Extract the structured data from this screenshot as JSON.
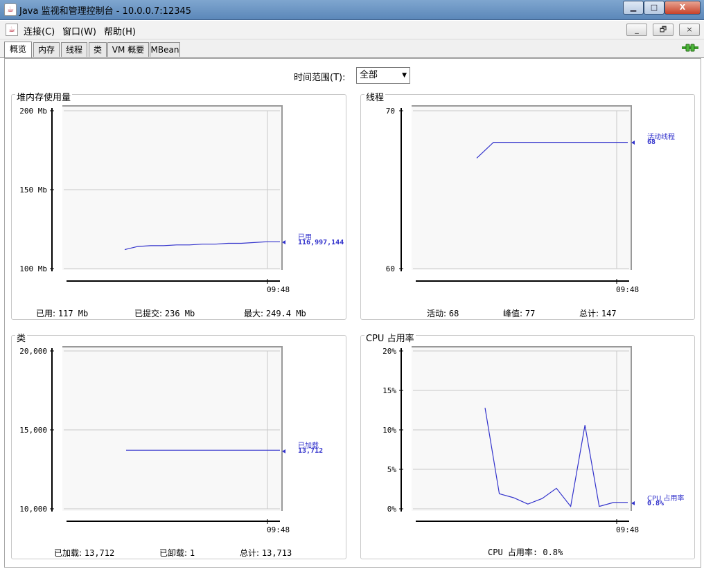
{
  "window": {
    "title": "Java 监视和管理控制台 - 10.0.0.7:12345",
    "min": "▁",
    "max": "□",
    "close": "X"
  },
  "menubar": {
    "items": [
      "连接(C)",
      "窗口(W)",
      "帮助(H)"
    ],
    "mdi_min": "_",
    "mdi_restore": "🗗",
    "mdi_close": "×"
  },
  "tabs": [
    "概览",
    "内存",
    "线程",
    "类",
    "VM 概要",
    "MBean"
  ],
  "time_range": {
    "label": "时间范围(T):",
    "value": "全部"
  },
  "panels": {
    "heap": {
      "title": "堆内存使用量",
      "y_ticks": [
        "200 Mb",
        "150 Mb",
        "100 Mb"
      ],
      "x_tick": "09:48",
      "legend_name": "已用",
      "legend_value": "116,997,144",
      "summary": [
        {
          "k": "已用:",
          "v": "117  Mb"
        },
        {
          "k": "已提交:",
          "v": "236  Mb"
        },
        {
          "k": "最大:",
          "v": "249.4  Mb"
        }
      ]
    },
    "threads": {
      "title": "线程",
      "y_ticks": [
        "70",
        "60"
      ],
      "x_tick": "09:48",
      "legend_name": "活动线程",
      "legend_value": "68",
      "summary": [
        {
          "k": "活动:",
          "v": "68"
        },
        {
          "k": "峰值:",
          "v": "77"
        },
        {
          "k": "总计:",
          "v": "147"
        }
      ]
    },
    "classes": {
      "title": "类",
      "y_ticks": [
        "20,000",
        "15,000",
        "10,000"
      ],
      "x_tick": "09:48",
      "legend_name": "已加载",
      "legend_value": "13,712",
      "summary": [
        {
          "k": "已加载:",
          "v": "13,712"
        },
        {
          "k": "已卸载:",
          "v": "1"
        },
        {
          "k": "总计:",
          "v": "13,713"
        }
      ]
    },
    "cpu": {
      "title": "CPU 占用率",
      "y_ticks": [
        "20%",
        "15%",
        "10%",
        "5%",
        "0%"
      ],
      "x_tick": "09:48",
      "legend_name": "CPU 占用率",
      "legend_value": "0.8%",
      "summary_text": "CPU 占用率: 0.8%"
    }
  },
  "chart_data": [
    {
      "type": "line",
      "title": "堆内存使用量",
      "ylabel": "Mb",
      "ylim": [
        100,
        200
      ],
      "series": [
        {
          "name": "已用",
          "values": [
            112,
            114,
            114.5,
            114.5,
            115,
            115,
            115.5,
            115.5,
            116,
            116,
            116.5,
            117,
            117
          ]
        }
      ]
    },
    {
      "type": "line",
      "title": "线程",
      "ylim": [
        60,
        70
      ],
      "series": [
        {
          "name": "活动线程",
          "values": [
            67,
            68,
            68,
            68,
            68,
            68,
            68,
            68,
            68,
            68
          ]
        }
      ]
    },
    {
      "type": "line",
      "title": "类",
      "ylim": [
        10000,
        20000
      ],
      "series": [
        {
          "name": "已加载",
          "values": [
            13712,
            13712,
            13712,
            13712,
            13712,
            13712
          ]
        }
      ]
    },
    {
      "type": "line",
      "title": "CPU 占用率",
      "ylabel": "%",
      "ylim": [
        0,
        20
      ],
      "series": [
        {
          "name": "CPU 占用率",
          "values": [
            12.8,
            1.9,
            1.4,
            0.6,
            1.3,
            2.6,
            0.3,
            10.6,
            0.3,
            0.8,
            0.8
          ]
        }
      ]
    }
  ],
  "colors": {
    "line": "#3333cc",
    "grid": "#c8c8c8",
    "axis": "#000000"
  }
}
